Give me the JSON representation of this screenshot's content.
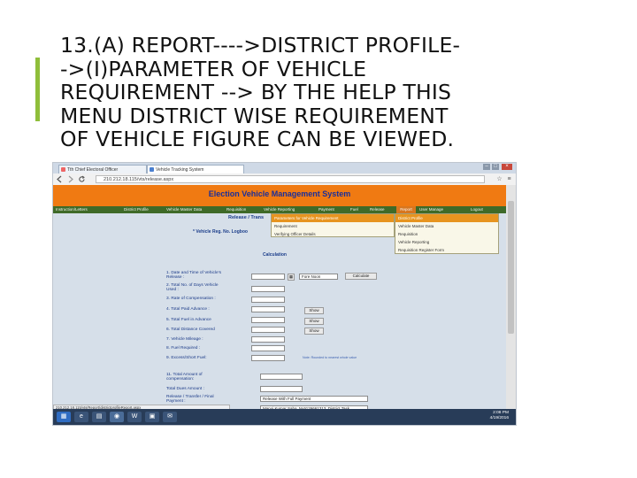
{
  "slide": {
    "title_lines": [
      "13.(A) REPORT---->DISTRICT PROFILE-",
      "->(I)PARAMETER OF VEHICLE",
      "REQUIREMENT --> BY THE HELP THIS",
      "MENU DISTRICT WISE REQUIREMENT",
      "OF VEHICLE FIGURE CAN BE VIEWED."
    ],
    "accent_color": "#8fbe3a"
  },
  "browser": {
    "tabs": [
      {
        "label": "Tth Chief Electoral Officer"
      },
      {
        "label": "Vehicle Tracking System"
      }
    ],
    "window_controls": [
      "–",
      "□",
      "×"
    ],
    "nav_icons": [
      "back-arrow",
      "forward-arrow",
      "reload"
    ],
    "url": "210.212.18.115/vts/release.aspx"
  },
  "app": {
    "title": "Election Vehicle Management System",
    "brand_color": "#f07a12",
    "menu": [
      {
        "label": "Instruction/Letters"
      },
      {
        "label": "District Profile"
      },
      {
        "label": "Vehicle Master Data"
      },
      {
        "label": "Requisition"
      },
      {
        "label": "Vehicle Reporting"
      },
      {
        "label": "Payment"
      },
      {
        "label": "Fuel"
      },
      {
        "label": "Release"
      },
      {
        "label": "Report"
      },
      {
        "label": "User Manage"
      },
      {
        "label": "Logout"
      }
    ],
    "submenu_report": [
      {
        "label": "District Profile"
      },
      {
        "label": "Vehicle Master Data"
      },
      {
        "label": "Requisition"
      },
      {
        "label": "Vehicle Reporting"
      },
      {
        "label": "Requisition Register Form"
      }
    ],
    "submenu_profile": [
      {
        "label": "Parameters for Vehicle Requirement"
      },
      {
        "label": "Requirement"
      },
      {
        "label": "Verifying Officer Details"
      }
    ],
    "page_heading": "Release / Trans",
    "vehicle_reg_label": "* Vehicle Reg. No. Logboo",
    "calculation_heading": "Calculation",
    "fields": [
      {
        "label": "1. Date and Time of Vehicle's",
        "label2": "Release :"
      },
      {
        "label": "2. Total No. of Days Vehicle",
        "label2": "Used :"
      },
      {
        "label": "3. Rate of Compensation :"
      },
      {
        "label": "4. Total Paid Advance :"
      },
      {
        "label": "5. Total Fuel in Advance"
      },
      {
        "label": "6. Total Distance Covered"
      },
      {
        "label": "7. Vehicle Mileage :"
      },
      {
        "label": "8. Fuel Required :"
      },
      {
        "label": "9. Excess/Short Fuel:"
      }
    ],
    "time_select": "Fore Noon",
    "calculate_button": "Calculate",
    "show_button": "Show",
    "note_link": "Note: Rounded to nearest whole value",
    "lower_fields": [
      {
        "label": "11. Total Amount of",
        "label2": "compensation:"
      },
      {
        "label": "Total Dues Amount :"
      },
      {
        "label": "Release / Transfer / Final",
        "label2": "Payment :"
      }
    ],
    "payment_select": "Release With Full Payment",
    "name_field": "Manoj Kumar Saha, M-9126661313, District Task"
  },
  "status_url": "210.212.18.115/vts/Report/districtprofileReport.aspx",
  "taskbar": {
    "items": [
      "▦",
      "e",
      "▤",
      "◉",
      "W",
      "▣",
      "✉"
    ],
    "time": "2:08 PM",
    "date": "4/19/2016"
  }
}
